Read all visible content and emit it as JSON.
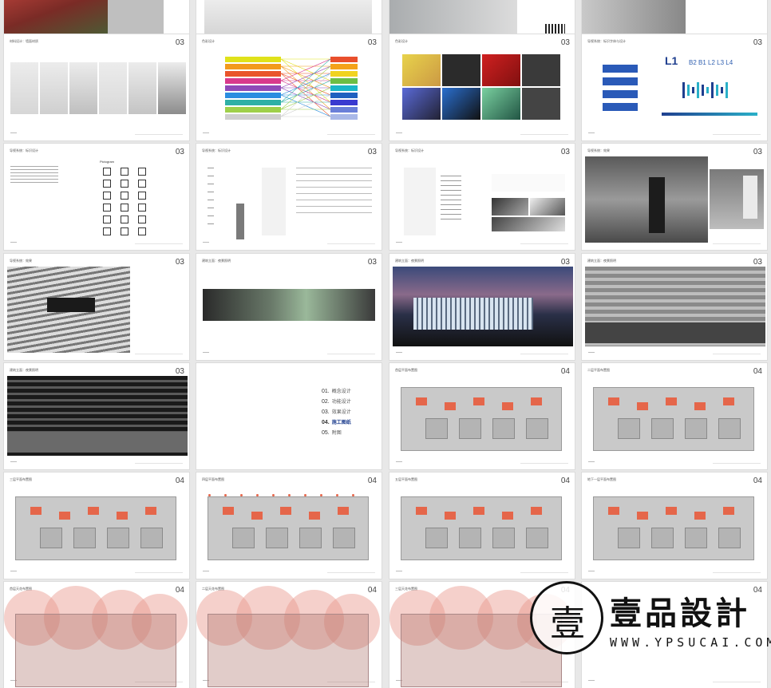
{
  "slides": [
    {
      "num": "",
      "title": ""
    },
    {
      "num": "",
      "title": ""
    },
    {
      "num": "",
      "title": ""
    },
    {
      "num": "",
      "title": ""
    },
    {
      "num": "03",
      "title": "材料设计：墙面材质"
    },
    {
      "num": "03",
      "title": "色彩设计"
    },
    {
      "num": "03",
      "title": "色彩设计"
    },
    {
      "num": "03",
      "title": "导视系统：标识字体与设计"
    },
    {
      "num": "03",
      "title": "导视系统：标识设计"
    },
    {
      "num": "03",
      "title": "导视系统：标识设计"
    },
    {
      "num": "03",
      "title": "导视系统：标识设计"
    },
    {
      "num": "03",
      "title": "导视系统：效果"
    },
    {
      "num": "03",
      "title": "导视系统：效果"
    },
    {
      "num": "03",
      "title": "建筑立面：夜景照明"
    },
    {
      "num": "03",
      "title": "建筑立面：夜景照明"
    },
    {
      "num": "03",
      "title": "建筑立面：夜景照明"
    },
    {
      "num": "03",
      "title": "建筑立面：夜景照明"
    },
    {
      "num": "",
      "title": ""
    },
    {
      "num": "04",
      "title": "首层平面布置图"
    },
    {
      "num": "04",
      "title": "二层平面布置图"
    },
    {
      "num": "04",
      "title": "三层平面布置图"
    },
    {
      "num": "04",
      "title": "四层平面布置图"
    },
    {
      "num": "04",
      "title": "五层平面布置图"
    },
    {
      "num": "04",
      "title": "地下一层平面布置图"
    },
    {
      "num": "04",
      "title": "首层天花布置图"
    },
    {
      "num": "04",
      "title": "二层天花布置图"
    },
    {
      "num": "04",
      "title": "三层天花布置图"
    },
    {
      "num": "04",
      "title": ""
    }
  ],
  "menu": [
    {
      "n": "01.",
      "label": "概念设计"
    },
    {
      "n": "02.",
      "label": "功能设计"
    },
    {
      "n": "03.",
      "label": "效果设计"
    },
    {
      "n": "04.",
      "label": "施工图纸"
    },
    {
      "n": "05.",
      "label": "附图"
    }
  ],
  "menu_active_index": 3,
  "pictogram_label": "Pictogram",
  "sign_level_big": "L1",
  "sign_levels": "B2 B1 L2 L3 L4",
  "watermark": {
    "brand": "壹品設計",
    "url": "WWW.YPSUCAI.COM",
    "glyph": "壹"
  }
}
